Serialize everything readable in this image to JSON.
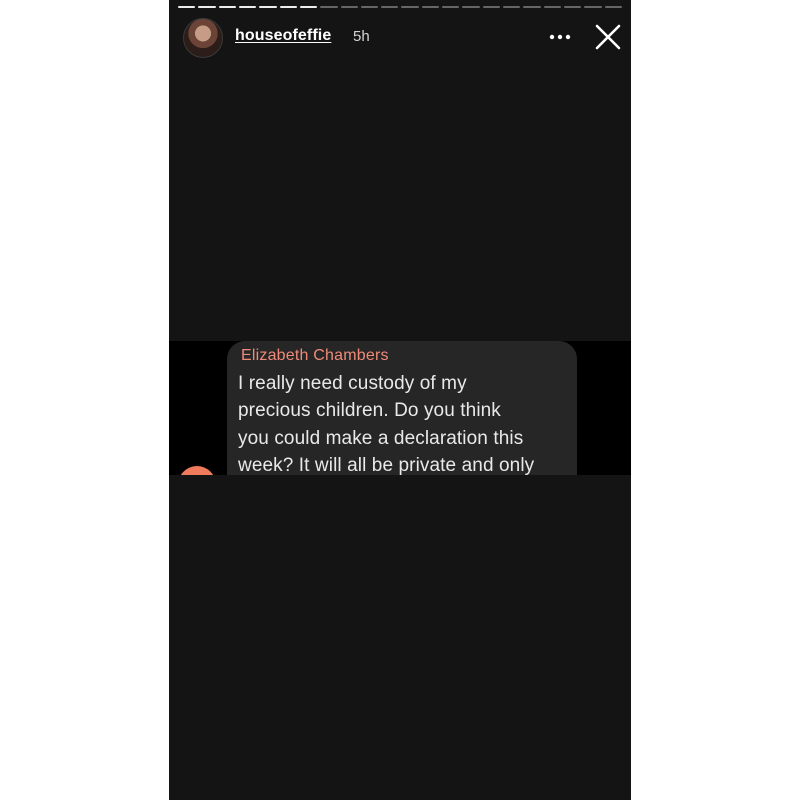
{
  "story": {
    "progress_segments_total": 22,
    "progress_segments_viewed": 7,
    "username": "houseofeffie",
    "timestamp": "5h",
    "icons": {
      "avatar": "profile-avatar",
      "more": "more-horizontal-icon",
      "close": "close-icon"
    }
  },
  "message": {
    "sender": "Elizabeth Chambers",
    "lines": [
      "I really need custody of my",
      "precious children. Do you think",
      "you could make a declaration this",
      "week? It will all be private and only"
    ]
  },
  "colors": {
    "background": "#141414",
    "bubble": "#262626",
    "sender_name": "#f08a78"
  }
}
